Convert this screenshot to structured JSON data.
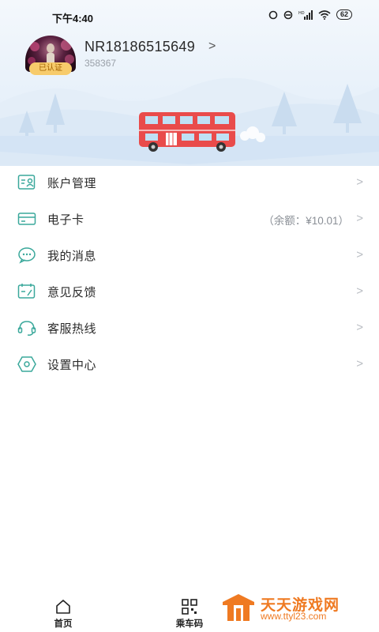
{
  "status_bar": {
    "time": "下午4:40",
    "battery": "62"
  },
  "profile": {
    "username": "NR18186515649",
    "arrow": ">",
    "user_id": "358367",
    "badge": "已认证"
  },
  "menu": {
    "items": [
      {
        "label": "账户管理",
        "icon": "account-card-icon",
        "extra": ""
      },
      {
        "label": "电子卡",
        "icon": "e-card-icon",
        "extra": "（余额：¥10.01）"
      },
      {
        "label": "我的消息",
        "icon": "message-bubble-icon",
        "extra": ""
      },
      {
        "label": "意见反馈",
        "icon": "feedback-icon",
        "extra": ""
      },
      {
        "label": "客服热线",
        "icon": "headset-icon",
        "extra": ""
      },
      {
        "label": "设置中心",
        "icon": "settings-hexagon-icon",
        "extra": ""
      }
    ],
    "chevron": ">"
  },
  "tabbar": {
    "home": "首页",
    "qr": "乘车码"
  },
  "watermark": {
    "title": "天天游戏网",
    "url": "www.ttyl23.com"
  },
  "colors": {
    "accent": "#3aa89b",
    "bus_red": "#e94b4b",
    "badge": "#f7cb6b",
    "watermark": "#ef7a22"
  }
}
